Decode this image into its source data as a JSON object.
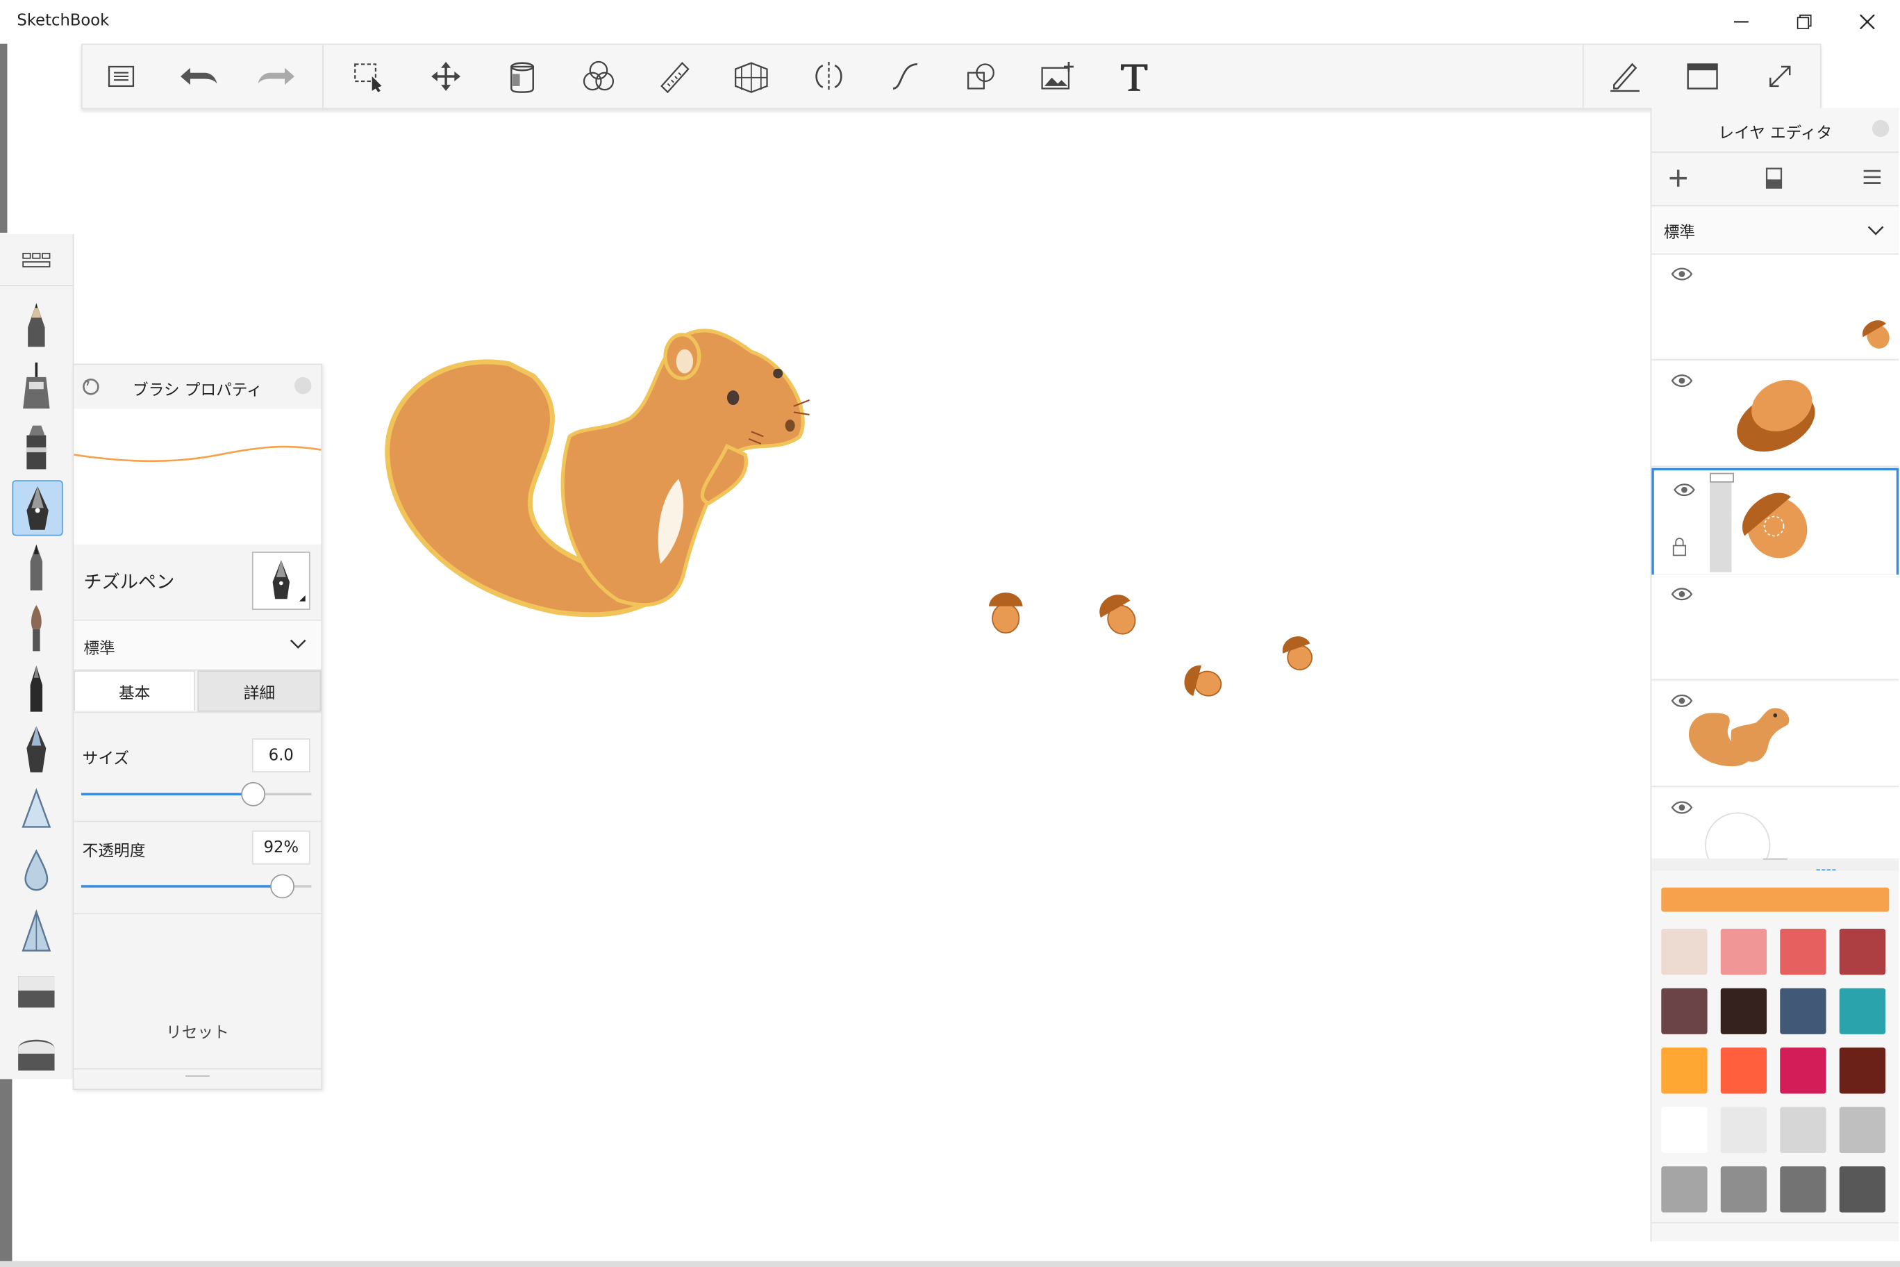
{
  "window": {
    "title": "SketchBook",
    "minimize_icon": "minimize-icon",
    "restore_icon": "restore-icon",
    "close_icon": "close-icon"
  },
  "toolbar": {
    "left_tools": [
      "list-icon",
      "undo-icon",
      "redo-icon"
    ],
    "center_tools": [
      "selection-icon",
      "move-transform-icon",
      "fill-bucket-icon",
      "color-editor-icon",
      "ruler-icon",
      "perspective-guide-icon",
      "symmetry-icon",
      "curve-icon",
      "shape-icon",
      "add-image-icon",
      "text-icon"
    ],
    "right_tools": [
      "brush-properties-icon",
      "ui-toggle-icon",
      "fullscreen-icon"
    ]
  },
  "brush_palette": {
    "brushes": [
      "pencil",
      "technical-pen",
      "marker",
      "chisel-pen",
      "ballpoint",
      "paint-brush",
      "ink-pen",
      "calligraphy-pen",
      "airbrush",
      "watercolor",
      "triangle-brush",
      "eraser",
      "soft-eraser"
    ],
    "selected_index": 3
  },
  "brush_properties": {
    "title": "ブラシ プロパティ",
    "brush_name": "チズルペン",
    "blend_mode": "標準",
    "tabs": [
      {
        "label": "基本",
        "active": true
      },
      {
        "label": "詳細",
        "active": false
      }
    ],
    "size": {
      "label": "サイズ",
      "value": "6.0",
      "level": 0.74
    },
    "opacity": {
      "label": "不透明度",
      "value": "92%",
      "level": 0.87
    },
    "reset_label": "リセット",
    "stroke_color": "#f6a14b"
  },
  "layer_editor": {
    "title": "レイヤ エディタ",
    "blend_mode": "標準",
    "tools": [
      "add-layer-icon",
      "clear-layer-icon",
      "layer-menu-icon"
    ],
    "layers": [
      {
        "name": "acorn-small",
        "visible": true,
        "selected": false
      },
      {
        "name": "acorn-large",
        "visible": true,
        "selected": false
      },
      {
        "name": "acorn-active",
        "visible": true,
        "selected": true,
        "locked": true
      },
      {
        "name": "empty",
        "visible": true,
        "selected": false
      },
      {
        "name": "squirrel",
        "visible": true,
        "selected": false
      },
      {
        "name": "background",
        "visible": true,
        "selected": false
      }
    ]
  },
  "colors": {
    "current": "#f6a14b",
    "swatches": [
      "#eddbd2",
      "#f09696",
      "#e66060",
      "#ad3e42",
      "#6a4446",
      "#35221e",
      "#415876",
      "#2aa3ac",
      "#ffa633",
      "#ff5f3d",
      "#d21d59",
      "#6b2117",
      "#ffffff",
      "#e8e8e8",
      "#d6d6d6",
      "#bfbfbf",
      "#a5a5a5",
      "#8e8e8e",
      "#737373",
      "#585858"
    ]
  }
}
